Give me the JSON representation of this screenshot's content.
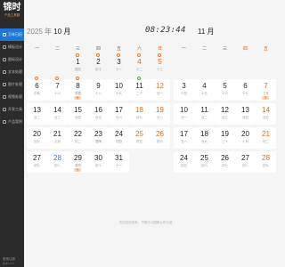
{
  "app": {
    "logo_main": "锦时",
    "logo_sub": "产品工具箱"
  },
  "sidebar": {
    "items": [
      {
        "label": "万年日历",
        "active": true
      },
      {
        "label": "模板设计"
      },
      {
        "label": "图标设计"
      },
      {
        "label": "文本处理"
      },
      {
        "label": "图片处理"
      },
      {
        "label": "视频处理"
      },
      {
        "label": "开发工具"
      },
      {
        "label": "产品案例"
      }
    ],
    "footer_line1": "登录注册",
    "footer_line2": "版本1.0.0"
  },
  "header": {
    "year_text": "2025 年",
    "month_text": "10 月",
    "clock": "08:23:44",
    "second_month": "11 月"
  },
  "weekdays": [
    "一",
    "二",
    "三",
    "四",
    "五",
    "六",
    "日"
  ],
  "footnote": "农历仅供参考，节假日以国家公布为准",
  "colors": {
    "accent": "#1e78d7",
    "weekend": "#e46a16",
    "holiday_tag_bg": "#fbd6b8"
  }
}
